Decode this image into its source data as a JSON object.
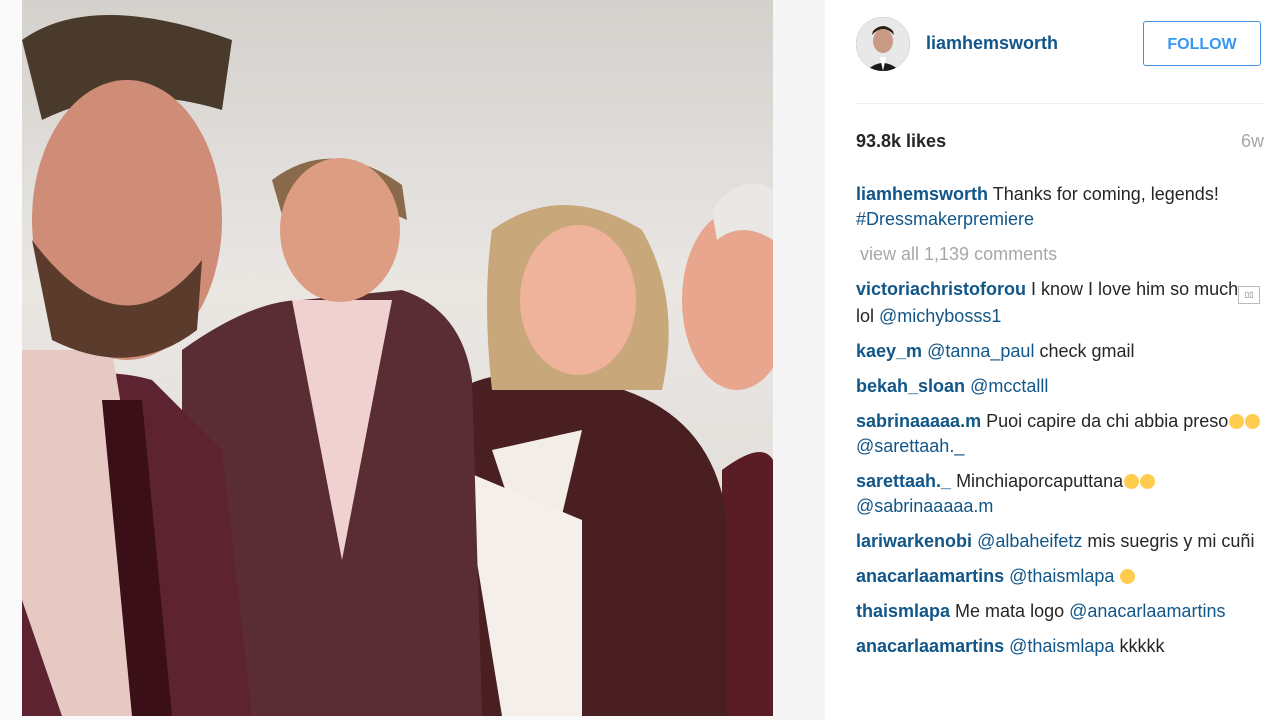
{
  "post": {
    "username": "liamhemsworth",
    "follow_label": "FOLLOW",
    "likes": "93.8k likes",
    "age": "6w",
    "caption_user": "liamhemsworth",
    "caption_text": " Thanks for coming, legends! ",
    "caption_hashtag": "#Dressmakerpremiere",
    "view_all": "view all 1,139 comments"
  },
  "comments": [
    {
      "user": "victoriachristoforou",
      "text": " I know I love him so much",
      "tail": " lol ",
      "mention": "@michybosss1"
    },
    {
      "user": "kaey_m",
      "mention": "@tanna_paul",
      "text": " check gmail"
    },
    {
      "user": "bekah_sloan",
      "mention": "@mcctalll"
    },
    {
      "user": "sabrinaaaaa.m",
      "text": " Puoi capire da chi abbia preso",
      "mention": "@sarettaah._"
    },
    {
      "user": "sarettaah._",
      "text": " Minchiaporcaputtana",
      "mention": "@sabrinaaaaa.m"
    },
    {
      "user": "lariwarkenobi",
      "mention": "@albaheifetz",
      "text": " mis suegris y mi cuñi"
    },
    {
      "user": "anacarlaamartins",
      "mention": "@thaismlapa"
    },
    {
      "user": "thaismlapa",
      "text": " Me mata logo ",
      "mention": "@anacarlaamartins"
    },
    {
      "user": "anacarlaamartins",
      "mention": "@thaismlapa",
      "text": " kkkkk"
    }
  ],
  "colors": {
    "link": "#125688",
    "follow": "#3897f0",
    "muted": "#a5a7aa"
  },
  "icons": [
    "profile-avatar",
    "sunglasses-emoji",
    "crying-laughing-emoji"
  ]
}
